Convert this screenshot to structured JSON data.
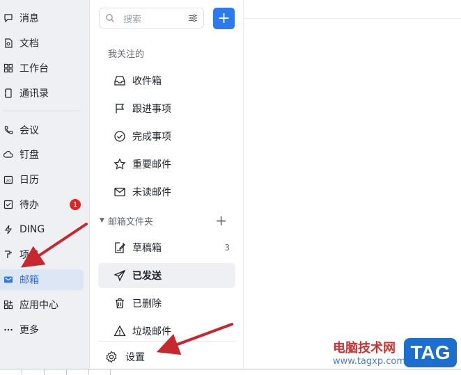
{
  "nav": {
    "items": [
      {
        "label": "消息",
        "icon": "chat-bubble-icon"
      },
      {
        "label": "文档",
        "icon": "document-icon"
      },
      {
        "label": "工作台",
        "icon": "grid-icon"
      },
      {
        "label": "通讯录",
        "icon": "contacts-icon"
      },
      {
        "label": "会议",
        "icon": "phone-icon"
      },
      {
        "label": "钉盘",
        "icon": "cloud-icon"
      },
      {
        "label": "日历",
        "icon": "calendar-icon"
      },
      {
        "label": "待办",
        "icon": "checkbox-icon",
        "badge": "1"
      },
      {
        "label": "DING",
        "icon": "lightning-icon"
      },
      {
        "label": "项目",
        "icon": "project-icon"
      },
      {
        "label": "邮箱",
        "icon": "mail-icon",
        "active": true
      },
      {
        "label": "应用中心",
        "icon": "apps-icon"
      },
      {
        "label": "更多",
        "icon": "more-icon"
      }
    ]
  },
  "mail": {
    "search_placeholder": "搜索",
    "add_label": "+",
    "following_title": "我关注的",
    "following": [
      {
        "label": "收件箱",
        "icon": "inbox-icon"
      },
      {
        "label": "跟进事项",
        "icon": "flag-icon"
      },
      {
        "label": "完成事项",
        "icon": "check-circle-icon"
      },
      {
        "label": "重要邮件",
        "icon": "star-icon"
      },
      {
        "label": "未读邮件",
        "icon": "envelope-icon"
      }
    ],
    "folder_title": "邮箱文件夹",
    "folder_add": "+",
    "folders": [
      {
        "label": "草稿箱",
        "icon": "draft-icon",
        "count": "3"
      },
      {
        "label": "已发送",
        "icon": "send-icon",
        "active": true
      },
      {
        "label": "已删除",
        "icon": "trash-icon"
      },
      {
        "label": "垃圾邮件",
        "icon": "warning-icon"
      }
    ],
    "settings_label": "设置"
  },
  "watermark": {
    "title": "电脑技术网",
    "url": "www.tagxp.com",
    "tag": "TAG"
  },
  "colors": {
    "accent": "#2c7af0",
    "badge": "#e02424",
    "arrow": "#c8272d"
  }
}
